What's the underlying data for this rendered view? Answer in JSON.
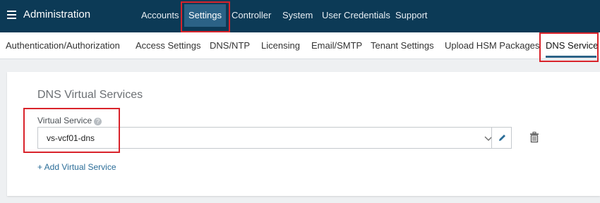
{
  "header": {
    "app_title": "Administration",
    "nav": [
      "Accounts",
      "Settings",
      "Controller",
      "System",
      "User Credentials",
      "Support"
    ],
    "active_nav": "Settings"
  },
  "subnav": {
    "items": [
      "Authentication/Authorization",
      "Access Settings",
      "DNS/NTP",
      "Licensing",
      "Email/SMTP",
      "Tenant Settings",
      "Upload HSM Packages",
      "DNS Service"
    ],
    "active_item": "DNS Service"
  },
  "dns_section": {
    "title": "DNS Virtual Services",
    "field_label": "Virtual Service",
    "help_glyph": "?",
    "selected_value": "vs-vcf01-dns",
    "add_link": "+ Add Virtual Service"
  },
  "icons": [
    "menu-icon",
    "help-icon",
    "chevron-down-icon",
    "pencil-icon",
    "trash-icon"
  ],
  "colors": {
    "header_bg": "#0c3a56",
    "active_tab_bg": "#2b6286",
    "highlight_border": "#d9232b",
    "link": "#2b6d98"
  }
}
